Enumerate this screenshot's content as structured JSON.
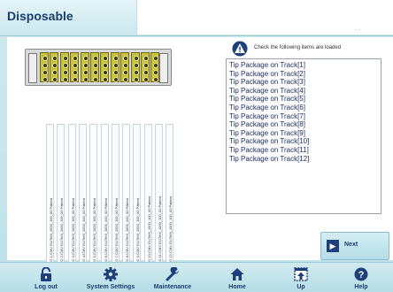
{
  "header": {
    "title": "Disposable"
  },
  "instruction": "Check the following items are loaded",
  "items": [
    "Tip Package on Track[1]",
    "Tip Package on Track[2]",
    "Tip Package on Track[3]",
    "Tip Package on Track[4]",
    "Tip Package on Track[5]",
    "Tip Package on Track[6]",
    "Tip Package on Track[7]",
    "Tip Package on Track[8]",
    "Tip Package on Track[9]",
    "Tip Package on Track[10]",
    "Tip Package on Track[11]",
    "Tip Package on Track[12]"
  ],
  "tracks": [
    "EG 1-CMV ELITeM_1000_100_00 Patient",
    "EG 2-CMV ELITeM_1000_100_00 Patient",
    "EG 3-CMV ELITeM_1000_100_00 Patient",
    "EG 4-CMV ELITeM_1000_100_00 Patient",
    "EG 5-CMV ELITeM_1000_100_00 Patient",
    "EG 6-CMV ELITeM_1000_100_00 Patient",
    "EG 7-CMV ELITeM_1000_100_00 Patient",
    "EG 8-CMV ELITeM_1000_100_00 Patient",
    "EG 9-CMV ELITeM_1000_100_00 Patient",
    "EG 10-CMV ELITeM_1000_100_00 Patient",
    "EG 11-CMV ELITeM_1000_100_00 Patient",
    "EG 12-CMV ELITeM_1000_100_00 Patient"
  ],
  "next_button": {
    "label": "Next"
  },
  "nav": {
    "logout": "Log out",
    "system_settings": "System Settings",
    "maintenance": "Maintenance",
    "home": "Home",
    "up": "Up",
    "help": "Help"
  },
  "colors": {
    "accent": "#1e3f7a",
    "tip": "#c8c23a",
    "background": "#cfe9ee"
  }
}
